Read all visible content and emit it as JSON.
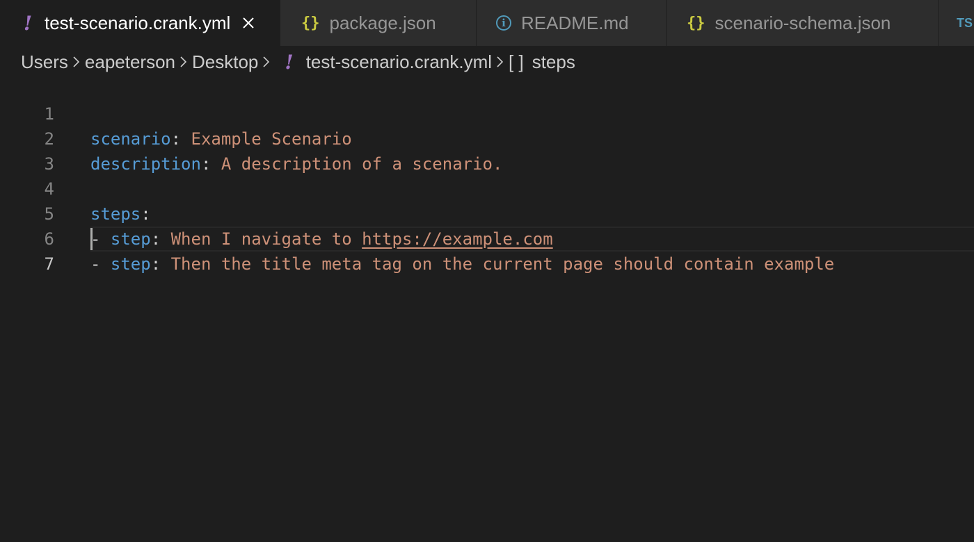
{
  "tabs": [
    {
      "label": "test-scenario.crank.yml",
      "icon": "yaml-icon",
      "icon_glyph": "!",
      "active": true,
      "close_glyph": "×"
    },
    {
      "label": "package.json",
      "icon": "json-icon",
      "icon_glyph": "{}",
      "active": false
    },
    {
      "label": "README.md",
      "icon": "info-icon",
      "icon_glyph": "i",
      "active": false
    },
    {
      "label": "scenario-schema.json",
      "icon": "json-icon",
      "icon_glyph": "{}",
      "active": false
    },
    {
      "label": "",
      "icon": "typescript-icon",
      "icon_glyph": "TS",
      "active": false
    }
  ],
  "breadcrumb": {
    "items": [
      "Users",
      "eapeterson",
      "Desktop",
      "test-scenario.crank.yml",
      "steps"
    ],
    "file_icon_glyph": "!",
    "symbol_icon_glyph": "[ ]"
  },
  "editor": {
    "lines": [
      {
        "num": "1",
        "key": "scenario",
        "colon": ":",
        "value": " Example Scenario"
      },
      {
        "num": "2",
        "key": "description",
        "colon": ":",
        "value": " A description of a scenario."
      },
      {
        "num": "3"
      },
      {
        "num": "4",
        "key": "steps",
        "colon": ":"
      },
      {
        "num": "5",
        "dash": "- ",
        "key": "step",
        "colon": ":",
        "value": " When I navigate to ",
        "link": "https://example.com"
      },
      {
        "num": "6",
        "dash": "- ",
        "key": "step",
        "colon": ":",
        "value": " Then the title meta tag on the current page should contain example"
      },
      {
        "num": "7"
      }
    ]
  },
  "colors": {
    "background": "#1e1e1e",
    "tab_inactive": "#2d2d2d",
    "key": "#569cd6",
    "string": "#ce9178",
    "yaml_icon": "#a074c4",
    "json_icon": "#cbcb41",
    "info_icon": "#519aba"
  }
}
